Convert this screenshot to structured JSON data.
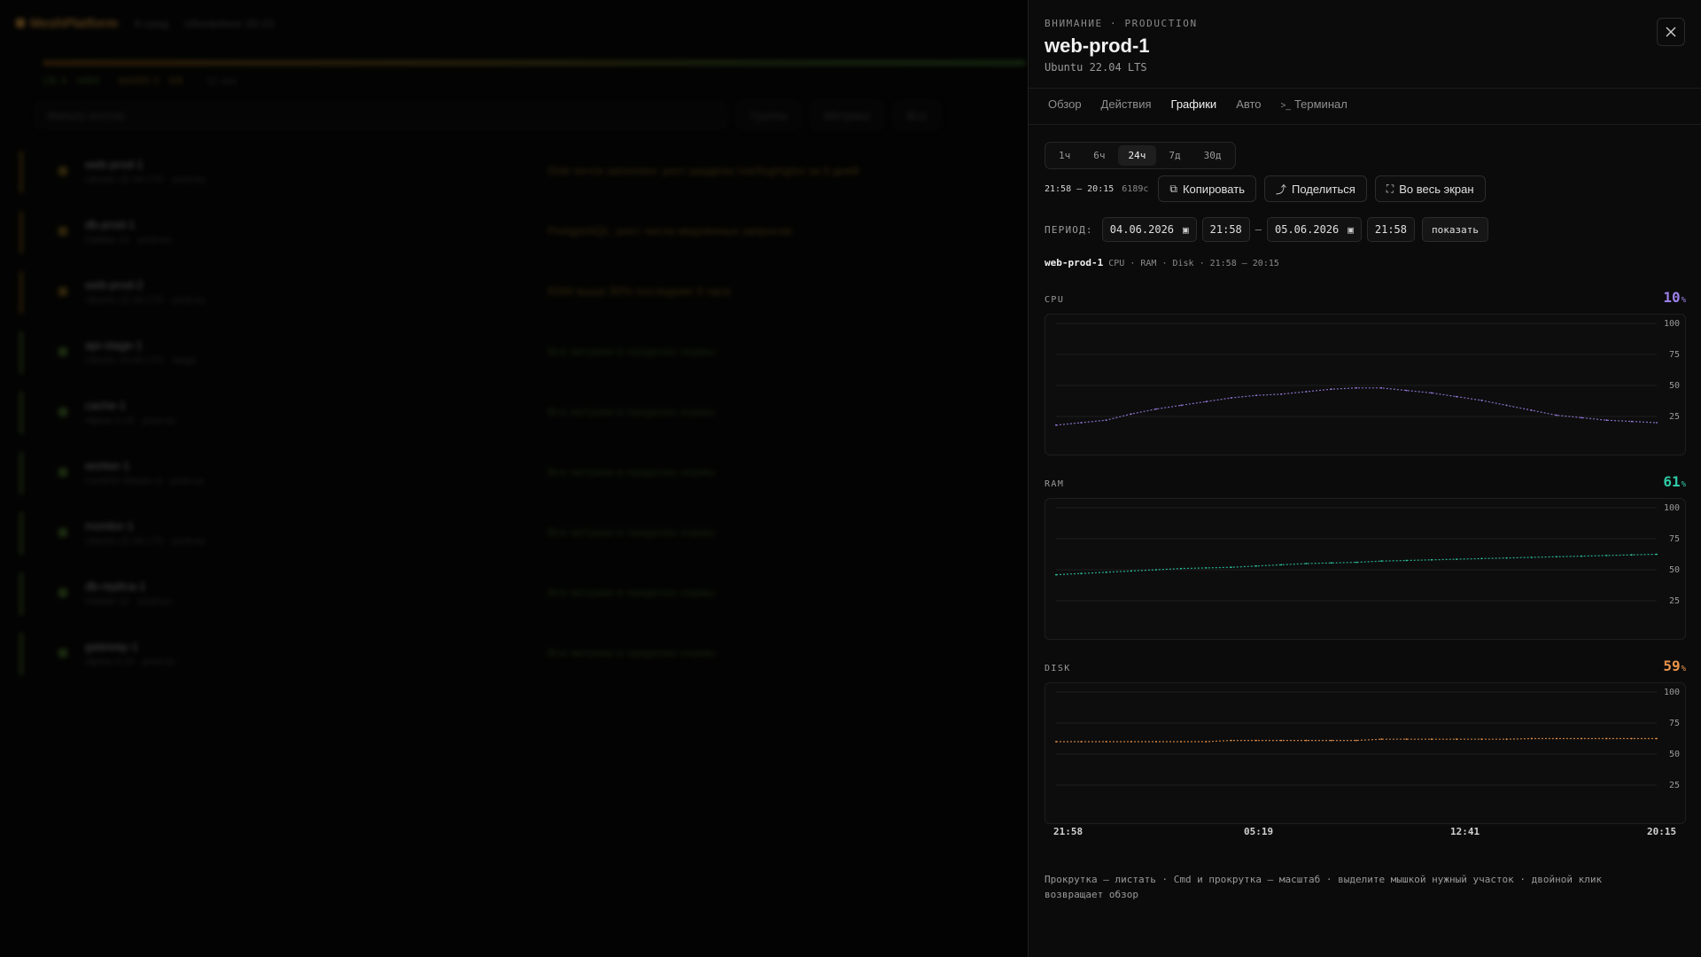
{
  "background": {
    "logo": "MeshPlatform",
    "top_muted": [
      "9 сред",
      "обновлено 20:15"
    ],
    "legend": [
      "OK 4 · 4464",
      "WARN 3 · 3/8",
      "· 11 sec"
    ],
    "search_placeholder": "Фильтр хостов",
    "selects": [
      "Группа",
      "Метрика",
      "Все"
    ],
    "rows": [
      {
        "name": "web-prod-1",
        "meta": "Ubuntu 22.04 LTS · prod-eu",
        "msg": "Disk почти заполнен: рост раздела /var/log/nginx за 5 дней",
        "level": "warn"
      },
      {
        "name": "db-prod-1",
        "meta": "Debian 12 · prod-eu",
        "msg": "PostgreSQL: рост числа медленных запросов",
        "level": "warn"
      },
      {
        "name": "web-prod-2",
        "meta": "Ubuntu 22.04 LTS · prod-eu",
        "msg": "RAM выше 80% последние 3 часа",
        "level": "warn"
      },
      {
        "name": "api-stage-1",
        "meta": "Ubuntu 24.04 LTS · stage",
        "msg": "Все метрики в пределах нормы",
        "level": "ok"
      },
      {
        "name": "cache-1",
        "meta": "Alpine 3.19 · prod-eu",
        "msg": "Все метрики в пределах нормы",
        "level": "ok"
      },
      {
        "name": "worker-1",
        "meta": "CentOS Stream 9 · prod-us",
        "msg": "Все метрики в пределах нормы",
        "level": "ok"
      },
      {
        "name": "monitor-1",
        "meta": "Ubuntu 22.04 LTS · prod-eu",
        "msg": "Все метрики в пределах нормы",
        "level": "ok"
      },
      {
        "name": "db-replica-1",
        "meta": "Debian 12 · prod-eu",
        "msg": "Все метрики в пределах нормы",
        "level": "ok"
      },
      {
        "name": "gateway-1",
        "meta": "Alpine 3.19 · prod-eu",
        "msg": "Все метрики в пределах нормы",
        "level": "ok"
      }
    ]
  },
  "drawer": {
    "eyebrow": "ВНИМАНИЕ · PRODUCTION",
    "title": "web-prod-1",
    "subtitle": "Ubuntu 22.04 LTS",
    "close_icon": "close-icon",
    "tabs": [
      {
        "label": "Обзор",
        "active": false
      },
      {
        "label": "Действия",
        "active": false
      },
      {
        "label": "Графики",
        "active": true
      },
      {
        "label": "Авто",
        "active": false
      },
      {
        "label": "Терминал",
        "active": false,
        "icon": "terminal-icon",
        "icon_glyph": ">_"
      }
    ],
    "ranges": [
      {
        "label": "1ч",
        "active": false
      },
      {
        "label": "6ч",
        "active": false
      },
      {
        "label": "24ч",
        "active": true
      },
      {
        "label": "7д",
        "active": false
      },
      {
        "label": "30д",
        "active": false
      }
    ],
    "range_label": "21:58 — 20:15",
    "points_count": "6189с",
    "actions": {
      "copy": {
        "label": "Копировать",
        "icon": "copy-icon",
        "glyph": "⧉"
      },
      "share": {
        "label": "Поделиться",
        "icon": "share-icon",
        "glyph": "⤴"
      },
      "fullscreen": {
        "label": "Во весь экран",
        "icon": "fullscreen-icon",
        "glyph": "⛶"
      }
    },
    "period": {
      "label": "ПЕРИОД:",
      "from_date": "04.06.2026",
      "from_time": "21:58",
      "dash": "—",
      "to_date": "05.06.2026",
      "to_time": "21:58",
      "calendar_glyph": "▣",
      "show_button": "показать"
    },
    "summary": {
      "host": "web-prod-1",
      "details": "CPU · RAM · Disk · 21:58 — 20:15"
    },
    "hint": "Прокрутка — листать · Cmd и прокрутка — масштаб · выделите мышкой нужный участок · двойной клик возвращает обзор"
  },
  "chart_data": [
    {
      "type": "line",
      "name": "CPU",
      "title": "CPU",
      "current_value": "10",
      "unit": "%",
      "color": "#9b7fe6",
      "ylim": [
        0,
        100
      ],
      "yticks": [
        100,
        75,
        50,
        25
      ],
      "x": [
        "21:58",
        "05:19",
        "12:41",
        "20:15"
      ],
      "values": [
        18,
        20,
        22,
        27,
        31,
        34,
        37,
        40,
        42,
        43,
        45,
        47,
        48,
        48,
        46,
        44,
        41,
        38,
        34,
        30,
        26,
        24,
        22,
        21,
        20
      ],
      "grid": true
    },
    {
      "type": "line",
      "name": "RAM",
      "title": "RAM",
      "current_value": "61",
      "unit": "%",
      "color": "#2fc9a5",
      "ylim": [
        0,
        100
      ],
      "yticks": [
        100,
        75,
        50,
        25
      ],
      "x": [
        "21:58",
        "05:19",
        "12:41",
        "20:15"
      ],
      "values": [
        46,
        47,
        48,
        49,
        50,
        51,
        51.5,
        52,
        53,
        54,
        55,
        55.5,
        56,
        57,
        57.5,
        58,
        58.5,
        59,
        59.5,
        60,
        60.5,
        61,
        61.5,
        62,
        62.5
      ],
      "grid": true
    },
    {
      "type": "line",
      "name": "DISK",
      "title": "DISK",
      "current_value": "59",
      "unit": "%",
      "color": "#e8924a",
      "ylim": [
        0,
        100
      ],
      "yticks": [
        100,
        75,
        50,
        25
      ],
      "x": [
        "21:58",
        "05:19",
        "12:41",
        "20:15"
      ],
      "values": [
        60,
        60,
        60,
        60,
        60,
        60,
        60,
        61,
        61,
        61,
        61,
        61,
        61,
        62,
        62,
        62,
        62,
        62,
        62,
        62.5,
        62.5,
        62.5,
        62.5,
        62.5,
        62.5
      ],
      "grid": true
    }
  ],
  "x_axis_ticks": [
    "21:58",
    "05:19",
    "12:41",
    "20:15"
  ]
}
